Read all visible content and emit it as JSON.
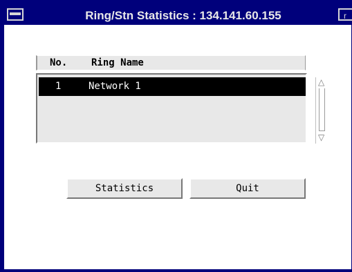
{
  "window": {
    "title": "Ring/Stn Statistics : 134.141.60.155",
    "menu_icon": "window-menu-icon",
    "right_icon": "window-control-icon",
    "right_glyph": "r"
  },
  "list": {
    "columns": {
      "no": "No.",
      "name": "Ring Name"
    },
    "rows": [
      {
        "no": "1",
        "name": "Network 1",
        "selected": true
      }
    ],
    "scroll_up_glyph": "△",
    "scroll_down_glyph": "▽"
  },
  "buttons": {
    "statistics": "Statistics",
    "quit": "Quit"
  },
  "colors": {
    "titlebar": "#00007b",
    "title_text": "#e8e8e8",
    "panel": "#e8e8e8",
    "selection": "#000000"
  }
}
